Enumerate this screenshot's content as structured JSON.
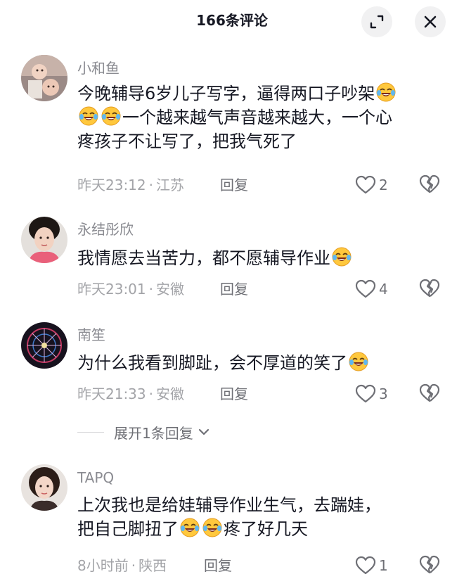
{
  "header": {
    "title": "166条评论"
  },
  "comments": [
    {
      "username": "小和鱼",
      "lines": [
        [
          "今晚辅导6岁儿子写字，逼得两口子吵架",
          "E"
        ],
        [
          "E",
          "E",
          "一个越来越气声音越来越大，一个心"
        ],
        [
          "疼孩子不让写了，把我气死了"
        ]
      ],
      "time": "昨天23:12",
      "location": "江苏",
      "reply_label": "回复",
      "likes": "2"
    },
    {
      "username": "永结彤欣",
      "lines": [
        [
          "我情愿去当苦力，都不愿辅导作业",
          "E"
        ]
      ],
      "time": "昨天23:01",
      "location": "安徽",
      "reply_label": "回复",
      "likes": "4"
    },
    {
      "username": "南笙",
      "lines": [
        [
          "为什么我看到脚趾，会不厚道的笑了",
          "E"
        ]
      ],
      "time": "昨天21:33",
      "location": "安徽",
      "reply_label": "回复",
      "likes": "3"
    },
    {
      "username": "TAPQ",
      "lines": [
        [
          "上次我也是给娃辅导作业生气，去踹娃，"
        ],
        [
          "把自己脚扭了",
          "E",
          "E",
          "疼了好几天"
        ]
      ],
      "time": "8小时前",
      "location": "陕西",
      "reply_label": "回复",
      "likes": "1"
    }
  ],
  "expand_replies": {
    "label": "展开1条回复"
  },
  "icons": {
    "expand": "expand-icon",
    "close": "close-icon",
    "like": "heart-outline-icon",
    "dislike": "broken-heart-icon",
    "emoji": "laughing-crying-emoji-icon",
    "chevron": "chevron-down-icon"
  },
  "colors": {
    "text_primary": "#161823",
    "text_secondary": "#8a8b91",
    "button_bg": "#f1f1f2",
    "emoji_face": "#ffc83d"
  }
}
